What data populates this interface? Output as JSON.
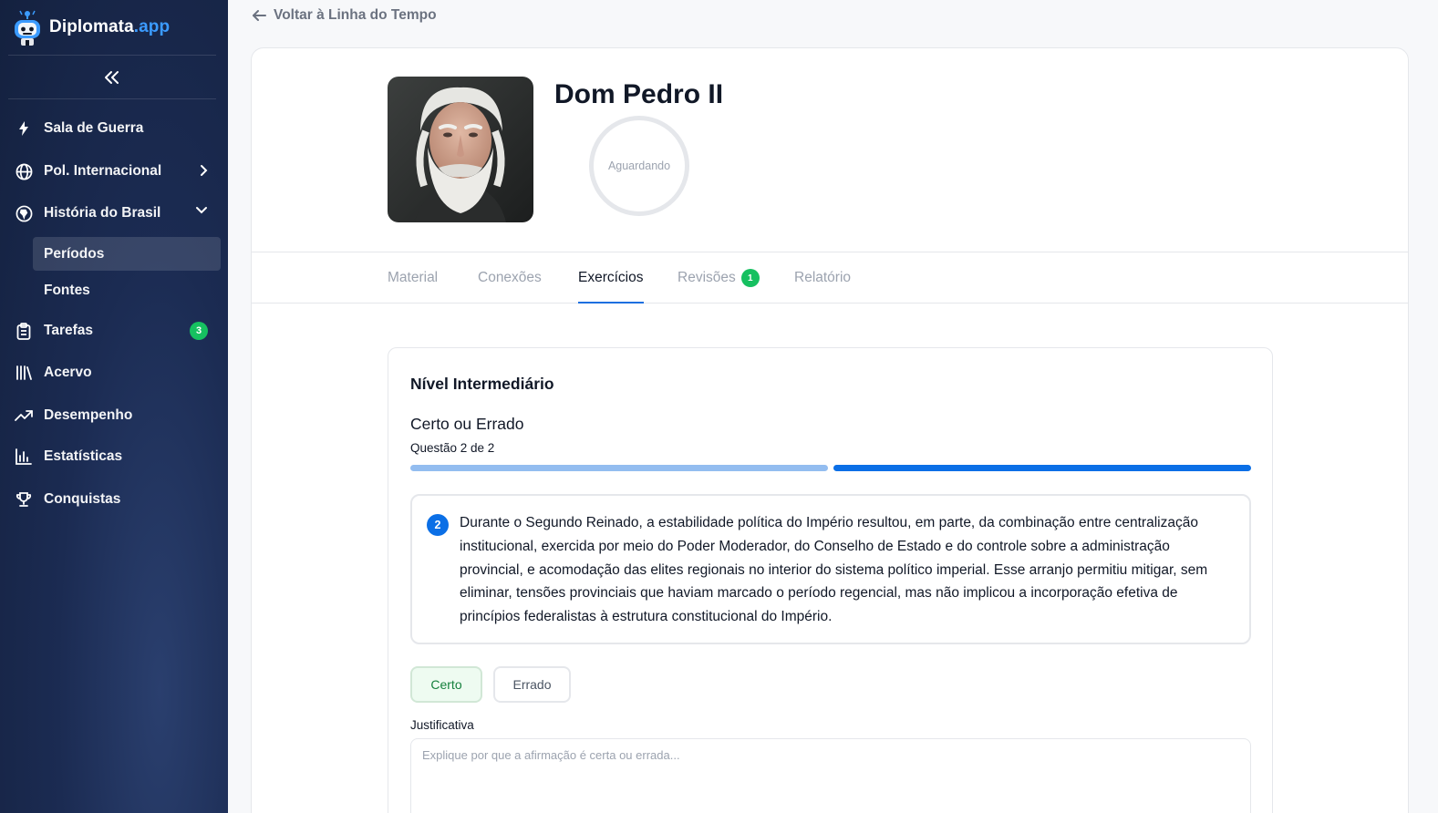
{
  "brand": {
    "name": "Diplomata",
    "suffix": ".app",
    "accent_color": "#3b9bff"
  },
  "sidebar": {
    "collapse_icon": "chevrons-left-icon",
    "items": [
      {
        "label": "Sala de Guerra",
        "icon": "lightning-icon"
      },
      {
        "label": "Pol. Internacional",
        "icon": "globe-icon",
        "chevron": "chevron-right-icon"
      },
      {
        "label": "História do Brasil",
        "icon": "brazil-globe-icon",
        "chevron": "chevron-down-icon"
      },
      {
        "label": "Tarefas",
        "icon": "clipboard-icon",
        "badge": "3"
      },
      {
        "label": "Acervo",
        "icon": "library-icon"
      },
      {
        "label": "Desempenho",
        "icon": "trending-up-icon"
      },
      {
        "label": "Estatísticas",
        "icon": "bar-chart-icon"
      },
      {
        "label": "Conquistas",
        "icon": "trophy-icon"
      }
    ],
    "sub_items": [
      {
        "label": "Períodos",
        "active": true
      },
      {
        "label": "Fontes",
        "active": false
      }
    ]
  },
  "header": {
    "back_label": "Voltar à Linha do Tempo"
  },
  "profile": {
    "name": "Dom Pedro II",
    "status": "Aguardando"
  },
  "tabs": [
    {
      "label": "Material"
    },
    {
      "label": "Conexões"
    },
    {
      "label": "Exercícios",
      "active": true
    },
    {
      "label": "Revisões",
      "badge": "1"
    },
    {
      "label": "Relatório"
    }
  ],
  "exercise": {
    "level": "Nível Intermediário",
    "type": "Certo ou Errado",
    "counter": "Questão 2 de 2",
    "progress": {
      "current": 2,
      "total": 2
    },
    "question_number": "2",
    "statement": "Durante o Segundo Reinado, a estabilidade política do Império resultou, em parte, da combinação entre centralização institucional, exercida por meio do Poder Moderador, do Conselho de Estado e do controle sobre a administração provincial, e acomodação das elites regionais no interior do sistema político imperial. Esse arranjo permitiu mitigar, sem eliminar, tensões provinciais que haviam marcado o período regencial, mas não implicou a incorporação efetiva de princípios federalistas à estrutura constitucional do Império.",
    "answer_true": "Certo",
    "answer_false": "Errado",
    "justification_label": "Justificativa",
    "justification_placeholder": "Explique por que a afirmação é certa ou errada..."
  }
}
